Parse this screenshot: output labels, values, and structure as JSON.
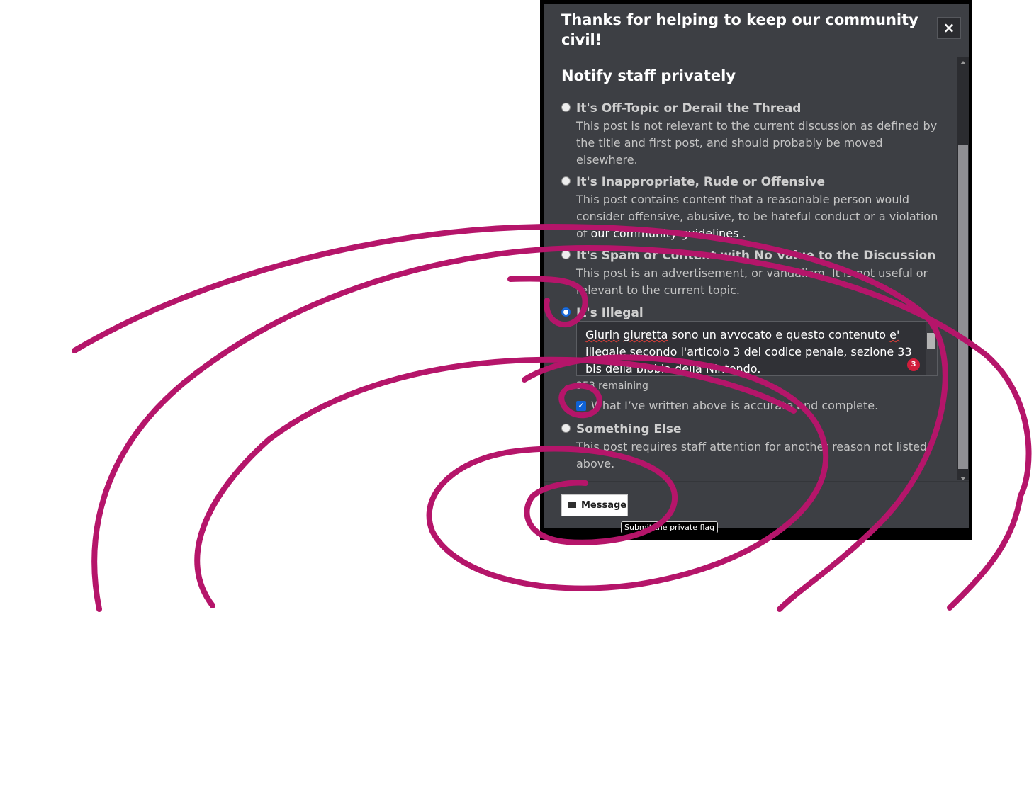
{
  "modal": {
    "title": "Thanks for helping to keep our community civil!",
    "close_label": "×",
    "section_title": "Notify staff privately",
    "options": [
      {
        "title": "It's Off-Topic or Derail the Thread",
        "description": "This post is not relevant to the current discussion as defined by the title and first post, and should probably be moved elsewhere.",
        "selected": false
      },
      {
        "title": "It's Inappropriate, Rude or Offensive",
        "description": "This post contains content that a reasonable person would consider offensive, abusive, to be hateful conduct or a violation of",
        "link_text": "our community guidelines",
        "description_suffix": ".",
        "selected": false
      },
      {
        "title": "It's Spam or Content with No Value to the Discussion",
        "description": "This post is an advertisement, or vandalism. It is not useful or relevant to the current topic.",
        "selected": false
      },
      {
        "title": "It's Illegal",
        "selected": true
      },
      {
        "title": "Something Else",
        "description": "This post requires staff attention for another reason not listed above.",
        "selected": false
      }
    ],
    "illegal_textarea": {
      "word1": "Giurin",
      "word2": "giuretta",
      "middle": "sono un avvocato e questo contenuto",
      "word3": "e'",
      "rest": "illegale secondo l'articolo 3 del codice penale, sezione 33 bis della bibbia della Nintendo.",
      "badge_count": "3"
    },
    "remaining_text": "353 remaining",
    "confirm_label": "What I’ve written above is accurate and complete.",
    "confirm_checked": true,
    "message_button_label": "Message",
    "tooltip": "Submit the private flag"
  },
  "icons": {
    "close": "close-icon",
    "mail": "envelope-icon",
    "check": "checkmark-icon"
  },
  "colors": {
    "modal_bg": "#3d3f44",
    "scribble": "#b5156a",
    "radio_selected": "#0e62d6"
  }
}
